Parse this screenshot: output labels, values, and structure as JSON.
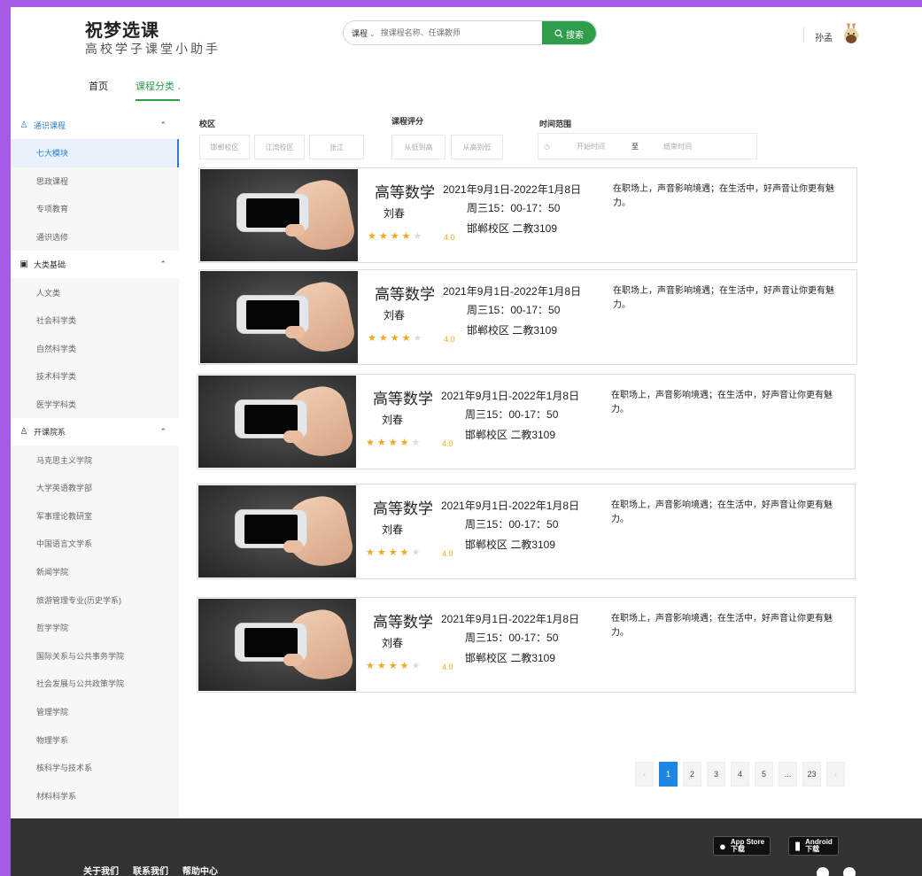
{
  "header": {
    "app_name": "祝梦选课",
    "tagline": "高校学子课堂小助手",
    "search": {
      "category": "课程",
      "placeholder": "搜课程名称、任课教师",
      "button": "搜索"
    },
    "user": {
      "name": "孙孟"
    }
  },
  "nav": {
    "home": "首页",
    "category": "课程分类"
  },
  "sidebar": {
    "groups": [
      {
        "label": "通识课程",
        "icon": "person-icon",
        "items": [
          "七大模块",
          "思政课程",
          "专项教育",
          "通识选修"
        ]
      },
      {
        "label": "大类基础",
        "icon": "calendar-icon",
        "items": [
          "人文类",
          "社会科学类",
          "自然科学类",
          "技术科学类",
          "医学学科类"
        ]
      },
      {
        "label": "开课院系",
        "icon": "user-icon",
        "items": [
          "马克思主义学院",
          "大学英语教学部",
          "军事理论教研室",
          "中国语言文学系",
          "新闻学院",
          "旅游管理专业(历史学系)",
          "哲学学院",
          "国际关系与公共事务学院",
          "社会发展与公共政策学院",
          "管理学院",
          "物理学系",
          "核科学与技术系",
          "材料科学系"
        ]
      }
    ]
  },
  "filters": {
    "campus_label": "校区",
    "campus_options": [
      "邯郸校区",
      "江湾校区",
      "张江"
    ],
    "rating_label": "课程评分",
    "rating_options": [
      "从低到高",
      "从高到低"
    ],
    "time_label": "时间范围",
    "time_start": "开始时间",
    "time_to": "至",
    "time_end": "结束时间"
  },
  "courses": [
    {
      "title": "高等数学",
      "date": "2021年9月1日-2022年1月8日",
      "teacher": "刘春",
      "time": "周三15：00-17：50",
      "location": "邯郸校区 二教3109",
      "rating": "4.0",
      "stars": 4,
      "desc": "在职场上，声音影响境遇；在生活中，好声音让你更有魅力。"
    },
    {
      "title": "高等数学",
      "date": "2021年9月1日-2022年1月8日",
      "teacher": "刘春",
      "time": "周三15：00-17：50",
      "location": "邯郸校区 二教3109",
      "rating": "4.0",
      "stars": 4,
      "desc": "在职场上，声音影响境遇；在生活中，好声音让你更有魅力。"
    },
    {
      "title": "高等数学",
      "date": "2021年9月1日-2022年1月8日",
      "teacher": "刘春",
      "time": "周三15：00-17：50",
      "location": "邯郸校区 二教3109",
      "rating": "4.0",
      "stars": 4,
      "desc": "在职场上，声音影响境遇；在生活中，好声音让你更有魅力。"
    },
    {
      "title": "高等数学",
      "date": "2021年9月1日-2022年1月8日",
      "teacher": "刘春",
      "time": "周三15：00-17：50",
      "location": "邯郸校区 二教3109",
      "rating": "4.0",
      "stars": 4,
      "desc": "在职场上，声音影响境遇；在生活中，好声音让你更有魅力。"
    },
    {
      "title": "高等数学",
      "date": "2021年9月1日-2022年1月8日",
      "teacher": "刘春",
      "time": "周三15：00-17：50",
      "location": "邯郸校区 二教3109",
      "rating": "4.0",
      "stars": 4,
      "desc": "在职场上，声音影响境遇；在生活中，好声音让你更有魅力。"
    }
  ],
  "pagination": {
    "prev": "‹",
    "pages": [
      "1",
      "2",
      "3",
      "4",
      "5",
      "...",
      "23"
    ],
    "next": "›",
    "current": "1"
  },
  "footer": {
    "links": [
      "关于我们",
      "联系我们",
      "帮助中心"
    ],
    "app_store": {
      "line1": "App Store",
      "line2": "下载"
    },
    "android": {
      "line1": "Android",
      "line2": "下载"
    }
  },
  "colors": {
    "accent_green": "#2e9e4a",
    "accent_blue": "#1c86e3",
    "frame_purple": "#a65be6",
    "star": "#f0a81e"
  }
}
